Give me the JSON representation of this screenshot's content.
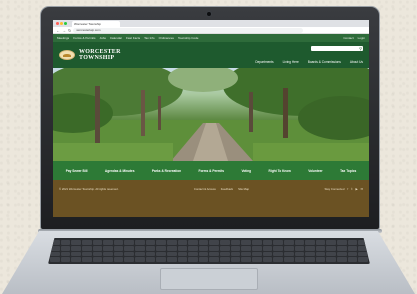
{
  "browser": {
    "tab_title": "Worcester Township",
    "url": "worcestertwp.com"
  },
  "utility_bar": {
    "links": [
      "Meetings",
      "Forms & Permits",
      "Jobs",
      "Calendar",
      "Fast Facts",
      "Tax Info",
      "Ordinances",
      "Township Code"
    ],
    "right_links": [
      "Contact",
      "Login"
    ]
  },
  "header": {
    "brand_line1": "WORCESTER",
    "brand_line2": "TOWNSHIP",
    "main_nav": [
      "Departments",
      "Living Here",
      "Boards & Commissions",
      "About Us"
    ]
  },
  "quick_links": [
    "Pay Sewer Bill",
    "Agendas & Minutes",
    "Parks & Recreation",
    "Forms & Permits",
    "Voting",
    "Right To Know",
    "Volunteer",
    "Tax Topics"
  ],
  "footer": {
    "copyright": "© 2021 Worcester Township. All rights reserved.",
    "links": [
      "Contact & Access",
      "Feedback",
      "Site Map"
    ],
    "follow_label": "Stay Connected"
  },
  "colors": {
    "utility_green": "#2e6b3a",
    "header_green": "#1e5a2e",
    "quicklinks_green": "#2d7a36",
    "footer_brown": "#6b5223"
  }
}
